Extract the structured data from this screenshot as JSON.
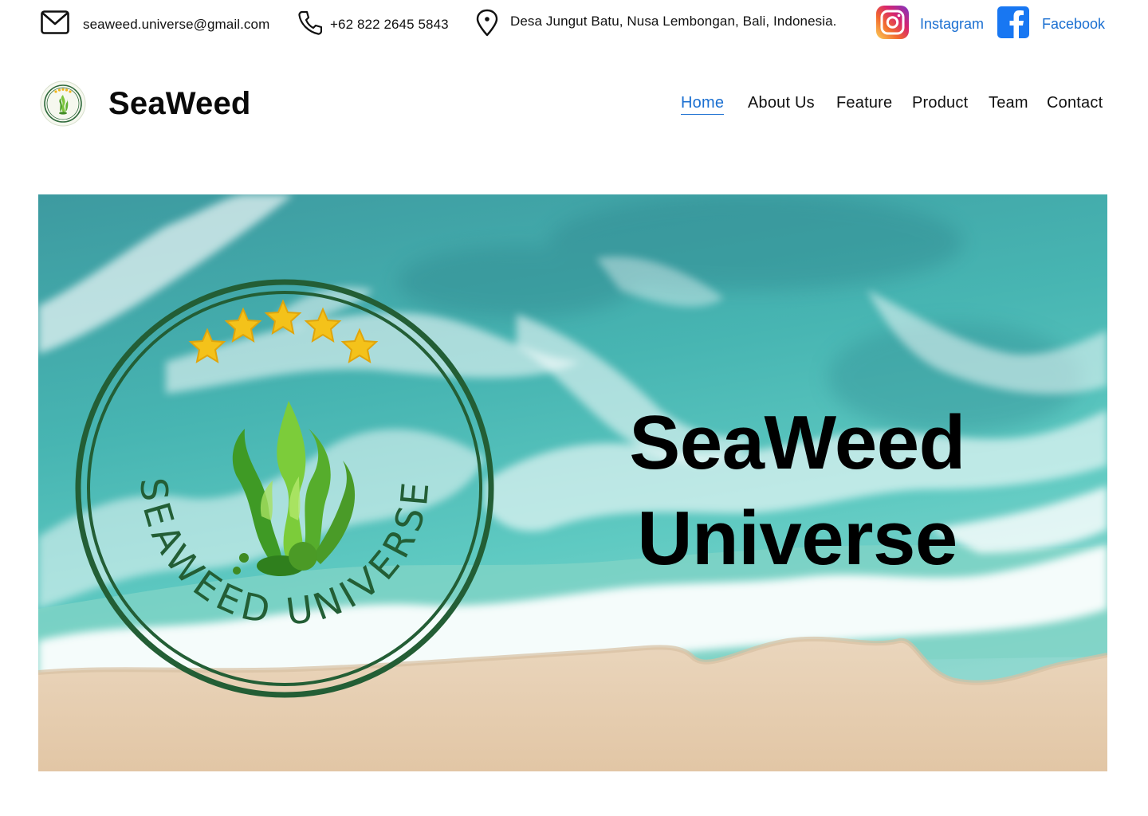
{
  "topbar": {
    "email": "seaweed.universe@gmail.com",
    "phone": "+62 822 2645 5843",
    "address": "Desa Jungut Batu, Nusa Lembongan, Bali, Indonesia.",
    "instagram_label": "Instagram",
    "facebook_label": "Facebook",
    "icons": {
      "email": "mail-icon",
      "phone": "phone-icon",
      "address": "map-pin-icon",
      "instagram": "instagram-icon",
      "facebook": "facebook-icon"
    }
  },
  "header": {
    "brand": "SeaWeed",
    "logo_text": "SEAWEED UNIVERSE"
  },
  "nav": {
    "items": [
      {
        "label": "Home",
        "active": true
      },
      {
        "label": "About Us",
        "active": false
      },
      {
        "label": "Feature",
        "active": false
      },
      {
        "label": "Product",
        "active": false
      },
      {
        "label": "Team",
        "active": false
      },
      {
        "label": "Contact",
        "active": false
      }
    ]
  },
  "hero": {
    "title_line1": "SeaWeed",
    "title_line2": "Universe",
    "emblem_text": "SEAWEED UNIVERSE",
    "stars": 5
  },
  "colors": {
    "link": "#1a6fd1",
    "sea": "#3fb3b0",
    "sand": "#e6cdb0",
    "emblem_green": "#235e35",
    "weed_green": "#6cc23a",
    "star": "#f4c21a"
  }
}
